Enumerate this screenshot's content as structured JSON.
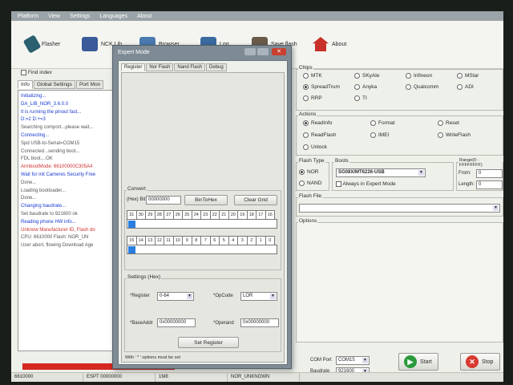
{
  "menubar": [
    "Platform",
    "View",
    "Settings",
    "Languages",
    "About"
  ],
  "toolbar": {
    "buttons": [
      {
        "label": "Flasher",
        "color": "#2a6070"
      },
      {
        "label": "NCK Lib",
        "color": "#3a5a9a"
      },
      {
        "label": "Browser",
        "color": "#4a7ab0"
      },
      {
        "label": "Log",
        "color": "#3a6aa0"
      },
      {
        "label": "Save flash",
        "color": "#6a5a4a"
      },
      {
        "label": "About",
        "color": "#c8302a"
      }
    ]
  },
  "left": {
    "find_index_label": "Find index",
    "tabs": [
      "Info",
      "Global Settings",
      "Port Mon"
    ],
    "log": [
      {
        "text": "Initializing...",
        "color": "#1a3ad0"
      },
      {
        "text": "DA_LIB_NOR_3.6.0.0",
        "color": "#1a3ad0"
      },
      {
        "text": "It is running the pinout fast...",
        "color": "#1a3ad0"
      },
      {
        "text": "D:=2 D:+=3",
        "color": "#1a3ad0"
      },
      {
        "text": "Searching comport...please wait...",
        "color": "#555"
      },
      {
        "text": "Connecting...",
        "color": "#1a3ad0"
      },
      {
        "text": "Spd USB-to-Serial=COM15",
        "color": "#555"
      },
      {
        "text": "Connected...sending boot...",
        "color": "#555"
      },
      {
        "text": "FDL boot....OK",
        "color": "#555"
      },
      {
        "text": "ArmbootMode: 66100000C305A4",
        "color": "#d03030"
      },
      {
        "text": "Wait for init Cameres Security Free",
        "color": "#1a3ad0"
      },
      {
        "text": "Done...",
        "color": "#555"
      },
      {
        "text": "Loading bootloader...",
        "color": "#555"
      },
      {
        "text": "Done...",
        "color": "#555"
      },
      {
        "text": "Changing baudrate...",
        "color": "#1a3ad0"
      },
      {
        "text": "Set baudrate to 921600 ok",
        "color": "#555"
      },
      {
        "text": "Reading phone HW info...",
        "color": "#1a3ad0"
      },
      {
        "text": "Unknow Manufacturer ID, Flash do",
        "color": "#d03030"
      },
      {
        "text": "CPU: 6610000    Flash: NOR_UN",
        "color": "#555"
      },
      {
        "text": "User abort, flowing Download Age",
        "color": "#555"
      }
    ]
  },
  "dialog": {
    "title": "Expert Mode",
    "tabs": [
      "Register",
      "Nor Flash",
      "Nand Flash",
      "Debug"
    ],
    "convert_label": "Convert",
    "hex_label": "(Hex) Bit",
    "hex_value": "00000000",
    "btn_bin_to_hex": "BinToHex",
    "btn_clear_grid": "Clear Grid",
    "bits_high": [
      "31",
      "30",
      "29",
      "28",
      "27",
      "26",
      "25",
      "24",
      "23",
      "22",
      "21",
      "20",
      "19",
      "18",
      "17",
      "16"
    ],
    "bits_low": [
      "15",
      "14",
      "13",
      "12",
      "11",
      "10",
      "9",
      "8",
      "7",
      "6",
      "5",
      "4",
      "3",
      "2",
      "1",
      "0"
    ],
    "settings_label": "Settings (Hex)",
    "register_label": "*Register",
    "register_value": "0-64",
    "opcode_label": "*OpCode",
    "opcode_value": "LOR",
    "baseaddr_label": "*BaseAddr",
    "baseaddr_value": "0x00000000",
    "operand_label": "*Operand",
    "operand_value": "0x00000000",
    "btn_set_register": "Set Register",
    "note": "With ' * ' options must be set"
  },
  "right": {
    "chips_label": "Chips",
    "chips": [
      {
        "label": "MTK",
        "on": false
      },
      {
        "label": "SKyAle",
        "on": false
      },
      {
        "label": "Infineon",
        "on": false
      },
      {
        "label": "MStar",
        "on": false
      },
      {
        "label": "SpreadTrum",
        "on": true
      },
      {
        "label": "Anyka",
        "on": false
      },
      {
        "label": "Qualcomm",
        "on": false
      },
      {
        "label": "ADI",
        "on": false
      },
      {
        "label": "RRP",
        "on": false
      },
      {
        "label": "TI",
        "on": false
      }
    ],
    "actions_label": "Actions",
    "actions": [
      {
        "label": "ReadInfo",
        "on": true
      },
      {
        "label": "Format",
        "on": false
      },
      {
        "label": "Reset",
        "on": false
      },
      {
        "label": "ReadFlash",
        "on": false
      },
      {
        "label": "IMEI",
        "on": false
      },
      {
        "label": "WriteFlash",
        "on": false
      },
      {
        "label": "Unlock",
        "on": false
      }
    ],
    "flash_type_label": "Flash Type",
    "flash_types": [
      {
        "label": "NOR",
        "on": true
      },
      {
        "label": "NAND",
        "on": false
      }
    ],
    "boots_label": "Boots",
    "boot_value": "SG08X/MT6226-USB",
    "always_expert_label": "Always in Expert Mode",
    "range_label": "Range(0 - FFFFFFFF)",
    "from_label": "From:",
    "from_value": "0",
    "length_label": "Length:",
    "length_value": "0",
    "flash_file_label": "Flash File",
    "options_label": "Options",
    "com_port_label": "COM Port",
    "com_port_value": "COM15",
    "baudrate_label": "Baudrate",
    "baudrate_value": "921600",
    "start_label": "Start",
    "stop_label": "Stop"
  },
  "status": [
    "6610000",
    "ESPT 00000000",
    "1M8",
    "NOR_UNKNOWN"
  ]
}
